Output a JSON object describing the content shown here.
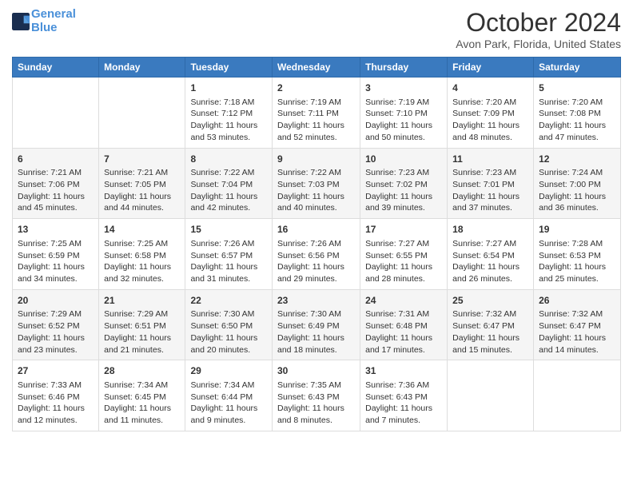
{
  "header": {
    "logo_line1": "General",
    "logo_line2": "Blue",
    "month_title": "October 2024",
    "location": "Avon Park, Florida, United States"
  },
  "days_of_week": [
    "Sunday",
    "Monday",
    "Tuesday",
    "Wednesday",
    "Thursday",
    "Friday",
    "Saturday"
  ],
  "weeks": [
    [
      {
        "day": "",
        "content": ""
      },
      {
        "day": "",
        "content": ""
      },
      {
        "day": "1",
        "content": "Sunrise: 7:18 AM\nSunset: 7:12 PM\nDaylight: 11 hours and 53 minutes."
      },
      {
        "day": "2",
        "content": "Sunrise: 7:19 AM\nSunset: 7:11 PM\nDaylight: 11 hours and 52 minutes."
      },
      {
        "day": "3",
        "content": "Sunrise: 7:19 AM\nSunset: 7:10 PM\nDaylight: 11 hours and 50 minutes."
      },
      {
        "day": "4",
        "content": "Sunrise: 7:20 AM\nSunset: 7:09 PM\nDaylight: 11 hours and 48 minutes."
      },
      {
        "day": "5",
        "content": "Sunrise: 7:20 AM\nSunset: 7:08 PM\nDaylight: 11 hours and 47 minutes."
      }
    ],
    [
      {
        "day": "6",
        "content": "Sunrise: 7:21 AM\nSunset: 7:06 PM\nDaylight: 11 hours and 45 minutes."
      },
      {
        "day": "7",
        "content": "Sunrise: 7:21 AM\nSunset: 7:05 PM\nDaylight: 11 hours and 44 minutes."
      },
      {
        "day": "8",
        "content": "Sunrise: 7:22 AM\nSunset: 7:04 PM\nDaylight: 11 hours and 42 minutes."
      },
      {
        "day": "9",
        "content": "Sunrise: 7:22 AM\nSunset: 7:03 PM\nDaylight: 11 hours and 40 minutes."
      },
      {
        "day": "10",
        "content": "Sunrise: 7:23 AM\nSunset: 7:02 PM\nDaylight: 11 hours and 39 minutes."
      },
      {
        "day": "11",
        "content": "Sunrise: 7:23 AM\nSunset: 7:01 PM\nDaylight: 11 hours and 37 minutes."
      },
      {
        "day": "12",
        "content": "Sunrise: 7:24 AM\nSunset: 7:00 PM\nDaylight: 11 hours and 36 minutes."
      }
    ],
    [
      {
        "day": "13",
        "content": "Sunrise: 7:25 AM\nSunset: 6:59 PM\nDaylight: 11 hours and 34 minutes."
      },
      {
        "day": "14",
        "content": "Sunrise: 7:25 AM\nSunset: 6:58 PM\nDaylight: 11 hours and 32 minutes."
      },
      {
        "day": "15",
        "content": "Sunrise: 7:26 AM\nSunset: 6:57 PM\nDaylight: 11 hours and 31 minutes."
      },
      {
        "day": "16",
        "content": "Sunrise: 7:26 AM\nSunset: 6:56 PM\nDaylight: 11 hours and 29 minutes."
      },
      {
        "day": "17",
        "content": "Sunrise: 7:27 AM\nSunset: 6:55 PM\nDaylight: 11 hours and 28 minutes."
      },
      {
        "day": "18",
        "content": "Sunrise: 7:27 AM\nSunset: 6:54 PM\nDaylight: 11 hours and 26 minutes."
      },
      {
        "day": "19",
        "content": "Sunrise: 7:28 AM\nSunset: 6:53 PM\nDaylight: 11 hours and 25 minutes."
      }
    ],
    [
      {
        "day": "20",
        "content": "Sunrise: 7:29 AM\nSunset: 6:52 PM\nDaylight: 11 hours and 23 minutes."
      },
      {
        "day": "21",
        "content": "Sunrise: 7:29 AM\nSunset: 6:51 PM\nDaylight: 11 hours and 21 minutes."
      },
      {
        "day": "22",
        "content": "Sunrise: 7:30 AM\nSunset: 6:50 PM\nDaylight: 11 hours and 20 minutes."
      },
      {
        "day": "23",
        "content": "Sunrise: 7:30 AM\nSunset: 6:49 PM\nDaylight: 11 hours and 18 minutes."
      },
      {
        "day": "24",
        "content": "Sunrise: 7:31 AM\nSunset: 6:48 PM\nDaylight: 11 hours and 17 minutes."
      },
      {
        "day": "25",
        "content": "Sunrise: 7:32 AM\nSunset: 6:47 PM\nDaylight: 11 hours and 15 minutes."
      },
      {
        "day": "26",
        "content": "Sunrise: 7:32 AM\nSunset: 6:47 PM\nDaylight: 11 hours and 14 minutes."
      }
    ],
    [
      {
        "day": "27",
        "content": "Sunrise: 7:33 AM\nSunset: 6:46 PM\nDaylight: 11 hours and 12 minutes."
      },
      {
        "day": "28",
        "content": "Sunrise: 7:34 AM\nSunset: 6:45 PM\nDaylight: 11 hours and 11 minutes."
      },
      {
        "day": "29",
        "content": "Sunrise: 7:34 AM\nSunset: 6:44 PM\nDaylight: 11 hours and 9 minutes."
      },
      {
        "day": "30",
        "content": "Sunrise: 7:35 AM\nSunset: 6:43 PM\nDaylight: 11 hours and 8 minutes."
      },
      {
        "day": "31",
        "content": "Sunrise: 7:36 AM\nSunset: 6:43 PM\nDaylight: 11 hours and 7 minutes."
      },
      {
        "day": "",
        "content": ""
      },
      {
        "day": "",
        "content": ""
      }
    ]
  ]
}
